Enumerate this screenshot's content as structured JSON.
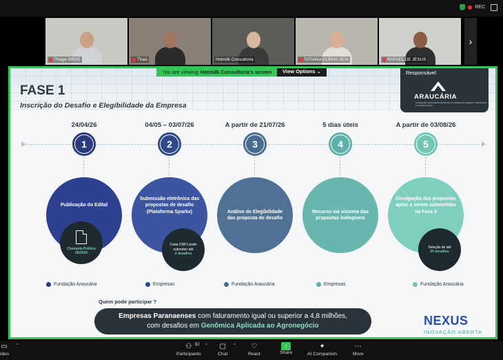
{
  "meeting": {
    "rec_label": "REC",
    "participants": [
      {
        "name": "Thiago BRDE",
        "muted": true,
        "bg": "#c9c9c4",
        "skin": "#c9a184",
        "shirt": "#cfd3d6"
      },
      {
        "name": "Thais",
        "muted": true,
        "bg": "#8a8078",
        "skin": "#a07460",
        "shirt": "#2b2b2b"
      },
      {
        "name": "Hotmilk Consultoria",
        "muted": false,
        "bg": "#5c5c58",
        "skin": "#d9b79f",
        "shirt": "#3b3b3b",
        "active": true
      },
      {
        "name": "TATIANA CUNHA   SEIA",
        "muted": true,
        "bg": "#b9b6b0",
        "skin": "#d8ae94",
        "shirt": "#e2ddd6"
      },
      {
        "name": "RAFAEL DE JESUS",
        "muted": true,
        "bg": "#cfd0cc",
        "skin": "#8a5d44",
        "shirt": "#2f2f2f"
      }
    ],
    "viewing_prefix": "You are viewing",
    "viewing_name": "Hotmilk Consultoria's screen",
    "view_options": "View Options"
  },
  "slide": {
    "title": "FASE 1",
    "subtitle": "Inscrição do Desafio e Elegibilidade da Empresa",
    "responsavel_label": "Responsável:",
    "responsavel_name": "ARAUCÁRIA",
    "responsavel_tag": "FUNDAÇÃO ARAUCÁRIA DE APOIO AO DESENVOLVIMENTO CIENTÍFICO E TECNOLÓGICO",
    "steps": [
      {
        "date": "24/04/26",
        "num": "1",
        "text": "Publicação do Edital",
        "mini_top": "",
        "mini_hl": "Chamada Pública 08/2026",
        "legend": "Fundação Araucária"
      },
      {
        "date": "04/05 – 03/07/26",
        "num": "2",
        "text": "Submissão eletrônica das propostas de desafio (Plataforma Sparkx)",
        "mini_top": "Cada CNPJ pode submeter até",
        "mini_hl": "2 desafios",
        "legend": "Empresas"
      },
      {
        "date": "A partir de 21/07/26",
        "num": "3",
        "text": "Análise de Elegibilidade das proposta de desafio",
        "mini_top": "",
        "mini_hl": "",
        "legend": "Fundação Araucária"
      },
      {
        "date": "5 dias úteis",
        "num": "4",
        "text": "Recurso via sistema das propostas inelegíveis",
        "mini_top": "",
        "mini_hl": "",
        "legend": "Empresas"
      },
      {
        "date": "A partir de 03/08/26",
        "num": "5",
        "text": "Divulgação das propostas aptas a serem submetidas na Fase 2",
        "mini_top": "Seleção de até",
        "mini_hl": "20 desafios",
        "legend": "Fundação Araucária"
      }
    ],
    "quem_label": "Quem pode participar ?",
    "who_bold": "Empresas Paranaenses",
    "who_rest": " com faturamento igual ou superior a 4,8 milhões,",
    "who_line2_pre": "com desafios em ",
    "who_line2_hl": "Genômica Aplicada ao Agronegócio",
    "nexus_name": "NEXUS",
    "nexus_sub": "INOVAÇÃO ABERTA"
  },
  "toolbar": {
    "video": "ideo",
    "participants": "Participants",
    "participants_count": "82",
    "chat": "Chat",
    "react": "React",
    "share": "Share",
    "ai": "AI Companion",
    "more": "More"
  },
  "colors": {
    "step_colors": [
      "#2a3a7a",
      "#2f4a8a",
      "#4a6c8e",
      "#5fb0a8",
      "#72c5b4"
    ],
    "circle_colors": [
      "#2e4190",
      "#3d54a0",
      "#4f7196",
      "#68b6ad",
      "#7fcfbf"
    ]
  }
}
